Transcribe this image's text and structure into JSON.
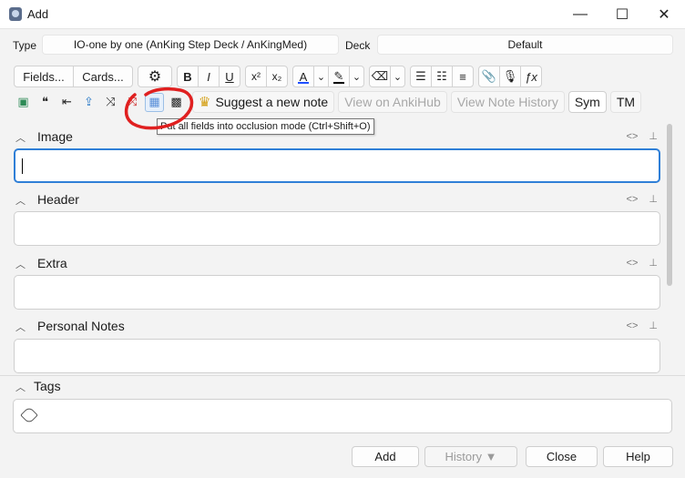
{
  "window": {
    "title": "Add",
    "controls": {
      "minimize": "—",
      "maximize": "☐",
      "close": "✕"
    }
  },
  "note_type": {
    "label": "Type",
    "value": "IO-one by one (AnKing Step Deck / AnKingMed)"
  },
  "deck": {
    "label": "Deck",
    "value": "Default"
  },
  "toolbar1": {
    "fields_label": "Fields...",
    "cards_label": "Cards...",
    "gear": "⚙",
    "bold": "B",
    "italic": "I",
    "underline": "U",
    "superscript": "x²",
    "subscript": "x₂",
    "text_color": "A",
    "highlight": "✎",
    "dropdown": "⌄",
    "eraser": "⌫",
    "bullet_list": "☰",
    "numbered_list": "☷",
    "align": "≡",
    "attach": "📎",
    "record": "🎙",
    "mathjax": "ƒx",
    "colors": {
      "text_color_bar": "#1f4fff",
      "highlight_bar": "#000000"
    }
  },
  "toolbar2": {
    "icons": [
      {
        "name": "image-occlusion-icon",
        "glyph": "▣",
        "color": "#2e8b57"
      },
      {
        "name": "speech-bubble-icon",
        "glyph": "❝",
        "color": "#222222"
      },
      {
        "name": "outdent-icon",
        "glyph": "⇤",
        "color": "#222222"
      },
      {
        "name": "upload-icon",
        "glyph": "⇪",
        "color": "#2a7ac7"
      },
      {
        "name": "shuffle-icon",
        "glyph": "⤨",
        "color": "#222222"
      },
      {
        "name": "shuffle-red-icon",
        "glyph": "⤨",
        "color": "#cc2a2a"
      },
      {
        "name": "occlusion-mode-icon",
        "glyph": "▦",
        "color": "#5a8fd8"
      },
      {
        "name": "grid-icon",
        "glyph": "▩",
        "color": "#222222"
      }
    ],
    "suggest_label": "Suggest a new note",
    "view_ankihub_label": "View on AnkiHub",
    "view_history_label": "View Note History",
    "sym_label": "Sym",
    "tm_label": "TM",
    "crown_glyph": "♛"
  },
  "tooltip": "Put all fields into occlusion mode (Ctrl+Shift+O)",
  "fields": [
    {
      "name": "Image"
    },
    {
      "name": "Header"
    },
    {
      "name": "Extra"
    },
    {
      "name": "Personal Notes"
    }
  ],
  "field_controls": {
    "html_toggle": "<>",
    "pin": "⊥"
  },
  "tags": {
    "label": "Tags"
  },
  "footer": {
    "add_label": "Add",
    "history_label": "History ▼",
    "close_label": "Close",
    "help_label": "Help"
  },
  "annotation_color": "#e02020"
}
